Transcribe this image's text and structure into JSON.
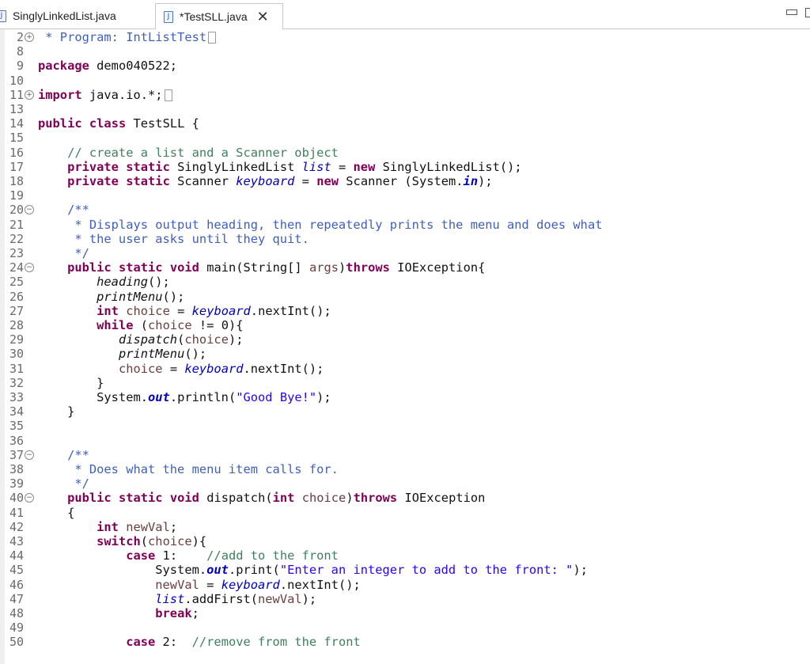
{
  "tabs": [
    {
      "label": "SinglyLinkedList.java",
      "icon": "java-file-icon",
      "active": false
    },
    {
      "label": "*TestSLL.java",
      "icon": "java-file-icon",
      "active": true,
      "close": "✕"
    }
  ],
  "editor": {
    "lines": [
      {
        "no": "2",
        "fold": "plus",
        "code": [
          {
            "t": " * Program: IntListTest",
            "c": "jd"
          },
          {
            "t": "",
            "c": "elide"
          }
        ]
      },
      {
        "no": "8",
        "code": []
      },
      {
        "no": "9",
        "code": [
          {
            "t": "package",
            "c": "kw"
          },
          {
            "t": " demo040522;",
            "c": ""
          }
        ]
      },
      {
        "no": "10",
        "code": []
      },
      {
        "no": "11",
        "fold": "plus",
        "code": [
          {
            "t": "import",
            "c": "kw"
          },
          {
            "t": " java.io.*;",
            "c": ""
          },
          {
            "t": "",
            "c": "elide"
          }
        ]
      },
      {
        "no": "13",
        "code": []
      },
      {
        "no": "14",
        "code": [
          {
            "t": "public",
            "c": "kw"
          },
          {
            "t": " ",
            "c": ""
          },
          {
            "t": "class",
            "c": "kw"
          },
          {
            "t": " TestSLL {",
            "c": ""
          }
        ]
      },
      {
        "no": "15",
        "code": []
      },
      {
        "no": "16",
        "code": [
          {
            "t": "    // create a list and a Scanner object",
            "c": "cm"
          }
        ]
      },
      {
        "no": "17",
        "code": [
          {
            "t": "    ",
            "c": ""
          },
          {
            "t": "private",
            "c": "kw"
          },
          {
            "t": " ",
            "c": ""
          },
          {
            "t": "static",
            "c": "kw"
          },
          {
            "t": " SinglyLinkedList ",
            "c": ""
          },
          {
            "t": "list",
            "c": "fld"
          },
          {
            "t": " = ",
            "c": ""
          },
          {
            "t": "new",
            "c": "kw"
          },
          {
            "t": " SinglyLinkedList();",
            "c": ""
          }
        ]
      },
      {
        "no": "18",
        "code": [
          {
            "t": "    ",
            "c": ""
          },
          {
            "t": "private",
            "c": "kw"
          },
          {
            "t": " ",
            "c": ""
          },
          {
            "t": "static",
            "c": "kw"
          },
          {
            "t": " Scanner ",
            "c": ""
          },
          {
            "t": "keyboard",
            "c": "fld"
          },
          {
            "t": " = ",
            "c": ""
          },
          {
            "t": "new",
            "c": "kw"
          },
          {
            "t": " Scanner (System.",
            "c": ""
          },
          {
            "t": "in",
            "c": "sfld"
          },
          {
            "t": ");",
            "c": ""
          }
        ]
      },
      {
        "no": "19",
        "code": []
      },
      {
        "no": "20",
        "fold": "minus",
        "code": [
          {
            "t": "    /**",
            "c": "jd"
          }
        ]
      },
      {
        "no": "21",
        "code": [
          {
            "t": "     * Displays output heading, then repeatedly prints the menu and does what",
            "c": "jd"
          }
        ]
      },
      {
        "no": "22",
        "code": [
          {
            "t": "     * the user asks until they quit.",
            "c": "jd"
          }
        ]
      },
      {
        "no": "23",
        "code": [
          {
            "t": "     */",
            "c": "jd"
          }
        ]
      },
      {
        "no": "24",
        "fold": "minus",
        "code": [
          {
            "t": "    ",
            "c": ""
          },
          {
            "t": "public",
            "c": "kw"
          },
          {
            "t": " ",
            "c": ""
          },
          {
            "t": "static",
            "c": "kw"
          },
          {
            "t": " ",
            "c": ""
          },
          {
            "t": "void",
            "c": "kw"
          },
          {
            "t": " main(String[] ",
            "c": ""
          },
          {
            "t": "args",
            "c": "var"
          },
          {
            "t": ")",
            "c": ""
          },
          {
            "t": "throws",
            "c": "kw"
          },
          {
            "t": " IOException{",
            "c": ""
          }
        ]
      },
      {
        "no": "25",
        "code": [
          {
            "t": "        ",
            "c": ""
          },
          {
            "t": "heading",
            "c": "mi"
          },
          {
            "t": "();",
            "c": ""
          }
        ]
      },
      {
        "no": "26",
        "code": [
          {
            "t": "        ",
            "c": ""
          },
          {
            "t": "printMenu",
            "c": "mi"
          },
          {
            "t": "();",
            "c": ""
          }
        ]
      },
      {
        "no": "27",
        "code": [
          {
            "t": "        ",
            "c": ""
          },
          {
            "t": "int",
            "c": "kw"
          },
          {
            "t": " ",
            "c": ""
          },
          {
            "t": "choice",
            "c": "var"
          },
          {
            "t": " = ",
            "c": ""
          },
          {
            "t": "keyboard",
            "c": "fld"
          },
          {
            "t": ".nextInt();",
            "c": ""
          }
        ]
      },
      {
        "no": "28",
        "code": [
          {
            "t": "        ",
            "c": ""
          },
          {
            "t": "while",
            "c": "kw"
          },
          {
            "t": " (",
            "c": ""
          },
          {
            "t": "choice",
            "c": "var"
          },
          {
            "t": " != 0){",
            "c": ""
          }
        ]
      },
      {
        "no": "29",
        "code": [
          {
            "t": "           ",
            "c": ""
          },
          {
            "t": "dispatch",
            "c": "mi"
          },
          {
            "t": "(",
            "c": ""
          },
          {
            "t": "choice",
            "c": "var"
          },
          {
            "t": ");",
            "c": ""
          }
        ]
      },
      {
        "no": "30",
        "code": [
          {
            "t": "           ",
            "c": ""
          },
          {
            "t": "printMenu",
            "c": "mi"
          },
          {
            "t": "();",
            "c": ""
          }
        ]
      },
      {
        "no": "31",
        "code": [
          {
            "t": "           ",
            "c": ""
          },
          {
            "t": "choice",
            "c": "var"
          },
          {
            "t": " = ",
            "c": ""
          },
          {
            "t": "keyboard",
            "c": "fld"
          },
          {
            "t": ".nextInt();",
            "c": ""
          }
        ]
      },
      {
        "no": "32",
        "code": [
          {
            "t": "        }",
            "c": ""
          }
        ]
      },
      {
        "no": "33",
        "code": [
          {
            "t": "        System.",
            "c": ""
          },
          {
            "t": "out",
            "c": "sfld"
          },
          {
            "t": ".println(",
            "c": ""
          },
          {
            "t": "\"Good Bye!\"",
            "c": "st"
          },
          {
            "t": ");",
            "c": ""
          }
        ]
      },
      {
        "no": "34",
        "code": [
          {
            "t": "    }",
            "c": ""
          }
        ]
      },
      {
        "no": "35",
        "code": []
      },
      {
        "no": "36",
        "code": []
      },
      {
        "no": "37",
        "fold": "minus",
        "code": [
          {
            "t": "    /**",
            "c": "jd"
          }
        ]
      },
      {
        "no": "38",
        "code": [
          {
            "t": "     * Does what the menu item calls for.",
            "c": "jd"
          }
        ]
      },
      {
        "no": "39",
        "code": [
          {
            "t": "     */",
            "c": "jd"
          }
        ]
      },
      {
        "no": "40",
        "fold": "minus",
        "code": [
          {
            "t": "    ",
            "c": ""
          },
          {
            "t": "public",
            "c": "kw"
          },
          {
            "t": " ",
            "c": ""
          },
          {
            "t": "static",
            "c": "kw"
          },
          {
            "t": " ",
            "c": ""
          },
          {
            "t": "void",
            "c": "kw"
          },
          {
            "t": " dispatch(",
            "c": ""
          },
          {
            "t": "int",
            "c": "kw"
          },
          {
            "t": " ",
            "c": ""
          },
          {
            "t": "choice",
            "c": "var"
          },
          {
            "t": ")",
            "c": ""
          },
          {
            "t": "throws",
            "c": "kw"
          },
          {
            "t": " IOException",
            "c": ""
          }
        ]
      },
      {
        "no": "41",
        "code": [
          {
            "t": "    {",
            "c": ""
          }
        ]
      },
      {
        "no": "42",
        "code": [
          {
            "t": "        ",
            "c": ""
          },
          {
            "t": "int",
            "c": "kw"
          },
          {
            "t": " ",
            "c": ""
          },
          {
            "t": "newVal",
            "c": "var"
          },
          {
            "t": ";",
            "c": ""
          }
        ]
      },
      {
        "no": "43",
        "code": [
          {
            "t": "        ",
            "c": ""
          },
          {
            "t": "switch",
            "c": "kw"
          },
          {
            "t": "(",
            "c": ""
          },
          {
            "t": "choice",
            "c": "var"
          },
          {
            "t": "){",
            "c": ""
          }
        ]
      },
      {
        "no": "44",
        "code": [
          {
            "t": "            ",
            "c": ""
          },
          {
            "t": "case",
            "c": "kw"
          },
          {
            "t": " 1:    ",
            "c": ""
          },
          {
            "t": "//add to the front",
            "c": "cm"
          }
        ]
      },
      {
        "no": "45",
        "code": [
          {
            "t": "                System.",
            "c": ""
          },
          {
            "t": "out",
            "c": "sfld"
          },
          {
            "t": ".print(",
            "c": ""
          },
          {
            "t": "\"Enter an integer to add to the front: \"",
            "c": "st"
          },
          {
            "t": ");",
            "c": ""
          }
        ]
      },
      {
        "no": "46",
        "code": [
          {
            "t": "                ",
            "c": ""
          },
          {
            "t": "newVal",
            "c": "var"
          },
          {
            "t": " = ",
            "c": ""
          },
          {
            "t": "keyboard",
            "c": "fld"
          },
          {
            "t": ".nextInt();",
            "c": ""
          }
        ]
      },
      {
        "no": "47",
        "code": [
          {
            "t": "                ",
            "c": ""
          },
          {
            "t": "list",
            "c": "fld"
          },
          {
            "t": ".addFirst(",
            "c": ""
          },
          {
            "t": "newVal",
            "c": "var"
          },
          {
            "t": ");",
            "c": ""
          }
        ]
      },
      {
        "no": "48",
        "code": [
          {
            "t": "                ",
            "c": ""
          },
          {
            "t": "break",
            "c": "kw"
          },
          {
            "t": ";",
            "c": ""
          }
        ]
      },
      {
        "no": "49",
        "code": []
      },
      {
        "no": "50",
        "code": [
          {
            "t": "            ",
            "c": ""
          },
          {
            "t": "case",
            "c": "kw"
          },
          {
            "t": " 2:  ",
            "c": ""
          },
          {
            "t": "//remove from the front",
            "c": "cm"
          }
        ]
      }
    ]
  }
}
